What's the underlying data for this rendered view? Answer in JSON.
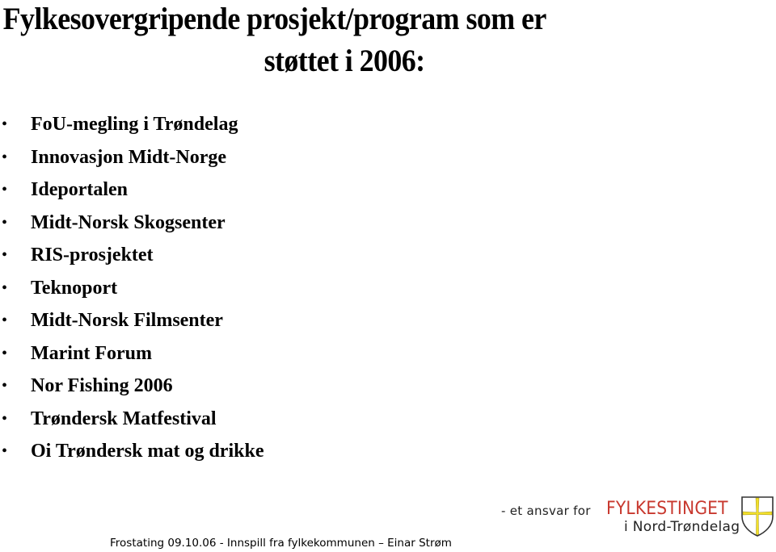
{
  "slide": {
    "title_line1": "Fylkesovergripende prosjekt/program som er",
    "title_line2": "støttet i 2006:",
    "bullet_glyph": "•",
    "bullets": [
      "FoU-megling i Trøndelag",
      "Innovasjon Midt-Norge",
      "Ideportalen",
      "Midt-Norsk Skogsenter",
      "RIS-prosjektet",
      "Teknoport",
      "Midt-Norsk Filmsenter",
      "Marint Forum",
      "Nor Fishing 2006",
      "Trøndersk Matfestival",
      "Oi Trøndersk mat og drikke"
    ]
  },
  "logo": {
    "tagline": "- et ansvar for",
    "brand": "FYLKESTINGET",
    "subtitle": "i Nord-Trøndelag",
    "icon": "coat-of-arms-shield",
    "brand_color": "#c8382e",
    "cross_color": "#f2e02a"
  },
  "footer": {
    "text": "Frostating 09.10.06 - Innspill fra fylkekommunen – Einar Strøm"
  }
}
